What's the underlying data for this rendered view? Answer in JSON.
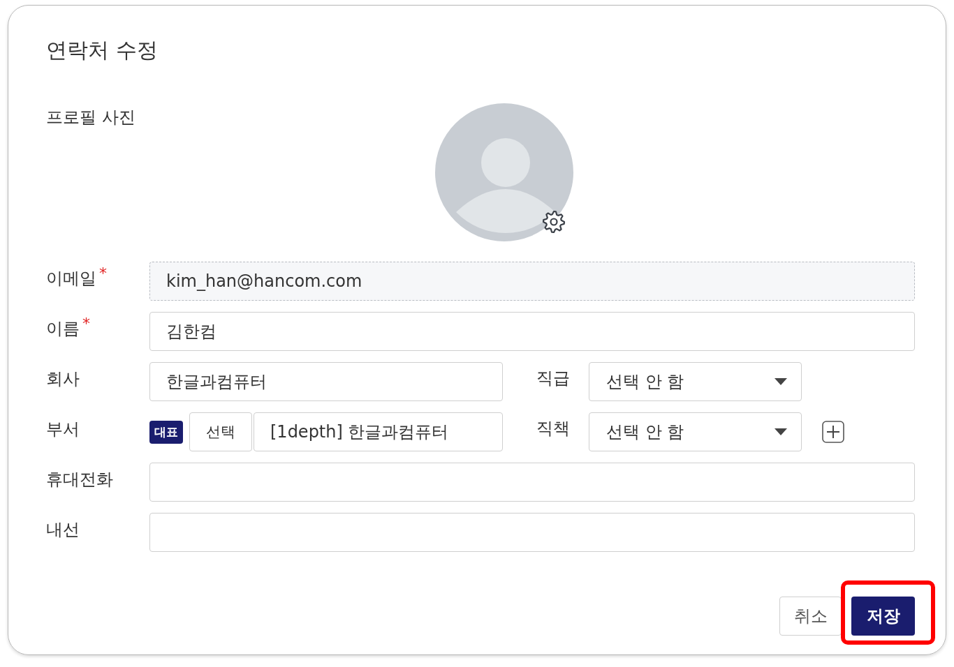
{
  "dialog": {
    "title": "연락처 수정"
  },
  "profile_photo": {
    "label": "프로필 사진"
  },
  "fields": [
    {
      "kind": "text",
      "label": "이메일",
      "required_mark": "*",
      "value": "kim_han@hancom.com",
      "readonly": true
    },
    {
      "kind": "text",
      "label": "이름",
      "required_mark": "*",
      "value": "김한컴",
      "readonly": false
    },
    {
      "kind": "pair",
      "label": "회사",
      "value": "한글과컴퓨터",
      "side": {
        "label": "직급",
        "value": "선택 안 함"
      }
    },
    {
      "kind": "department",
      "label": "부서",
      "badge": "대표",
      "pick_button": "선택",
      "value": "[1depth] 한글과컴퓨터",
      "side": {
        "label": "직책",
        "value": "선택 안 함"
      }
    },
    {
      "kind": "text",
      "label": "휴대전화",
      "readonly": false
    },
    {
      "kind": "text",
      "label": "내선",
      "readonly": false
    }
  ],
  "buttons": [
    {
      "kind": "secondary",
      "label": "취소",
      "highlighted": false
    },
    {
      "kind": "primary",
      "label": "저장",
      "highlighted": true
    }
  ]
}
